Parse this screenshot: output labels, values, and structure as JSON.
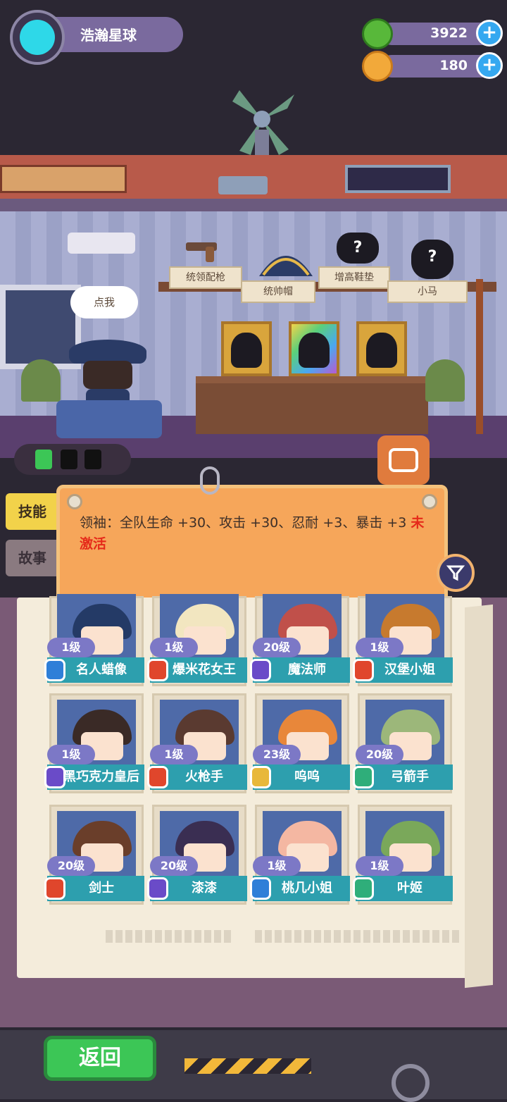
{
  "profile": {
    "name": "浩瀚星球"
  },
  "currencies": [
    {
      "icon": "green-gem-icon",
      "value": "3922"
    },
    {
      "icon": "gold-planet-coin-icon",
      "value": "180"
    }
  ],
  "room": {
    "speech_bubble": "点我",
    "shelf_items": [
      {
        "label": "统领配枪",
        "icon": "pistol-icon"
      },
      {
        "label": "统帅帽",
        "icon": "bicorne-hat-icon"
      },
      {
        "label": "增高鞋垫",
        "icon": "unknown-item-icon"
      },
      {
        "label": "小马",
        "icon": "unknown-item-icon"
      }
    ]
  },
  "tabs": {
    "skill": "技能",
    "story": "故事"
  },
  "skill_note": {
    "text": "领袖：全队生命 +30、攻击 +30、忍耐 +3、暴击 +3",
    "status": "未激活"
  },
  "characters": [
    {
      "level": "1级",
      "name": "名人蜡像",
      "role_color": "#2f7fd8",
      "hair": "#243a66"
    },
    {
      "level": "1级",
      "name": "爆米花女王",
      "role_color": "#e0462c",
      "hair": "#f2e6c0"
    },
    {
      "level": "20级",
      "name": "魔法师",
      "role_color": "#6a4bc8",
      "hair": "#c0504a"
    },
    {
      "level": "1级",
      "name": "汉堡小姐",
      "role_color": "#e0462c",
      "hair": "#c77a2e"
    },
    {
      "level": "1级",
      "name": "黑巧克力皇后",
      "role_color": "#6a4bc8",
      "hair": "#3a2a26"
    },
    {
      "level": "1级",
      "name": "火枪手",
      "role_color": "#e0462c",
      "hair": "#5a3a30"
    },
    {
      "level": "23级",
      "name": "呜呜",
      "role_color": "#e8b83a",
      "hair": "#e8873a"
    },
    {
      "level": "20级",
      "name": "弓箭手",
      "role_color": "#2fae7a",
      "hair": "#9cb77a"
    },
    {
      "level": "20级",
      "name": "剑士",
      "role_color": "#e0462c",
      "hair": "#6a3e2a"
    },
    {
      "level": "20级",
      "name": "漆漆",
      "role_color": "#6a4bc8",
      "hair": "#3a2e52"
    },
    {
      "level": "1级",
      "name": "桃几小姐",
      "role_color": "#2f7fd8",
      "hair": "#f4b7a2"
    },
    {
      "level": "1级",
      "name": "叶姬",
      "role_color": "#2fae7a",
      "hair": "#7aa85a"
    }
  ],
  "buttons": {
    "back": "返回"
  }
}
